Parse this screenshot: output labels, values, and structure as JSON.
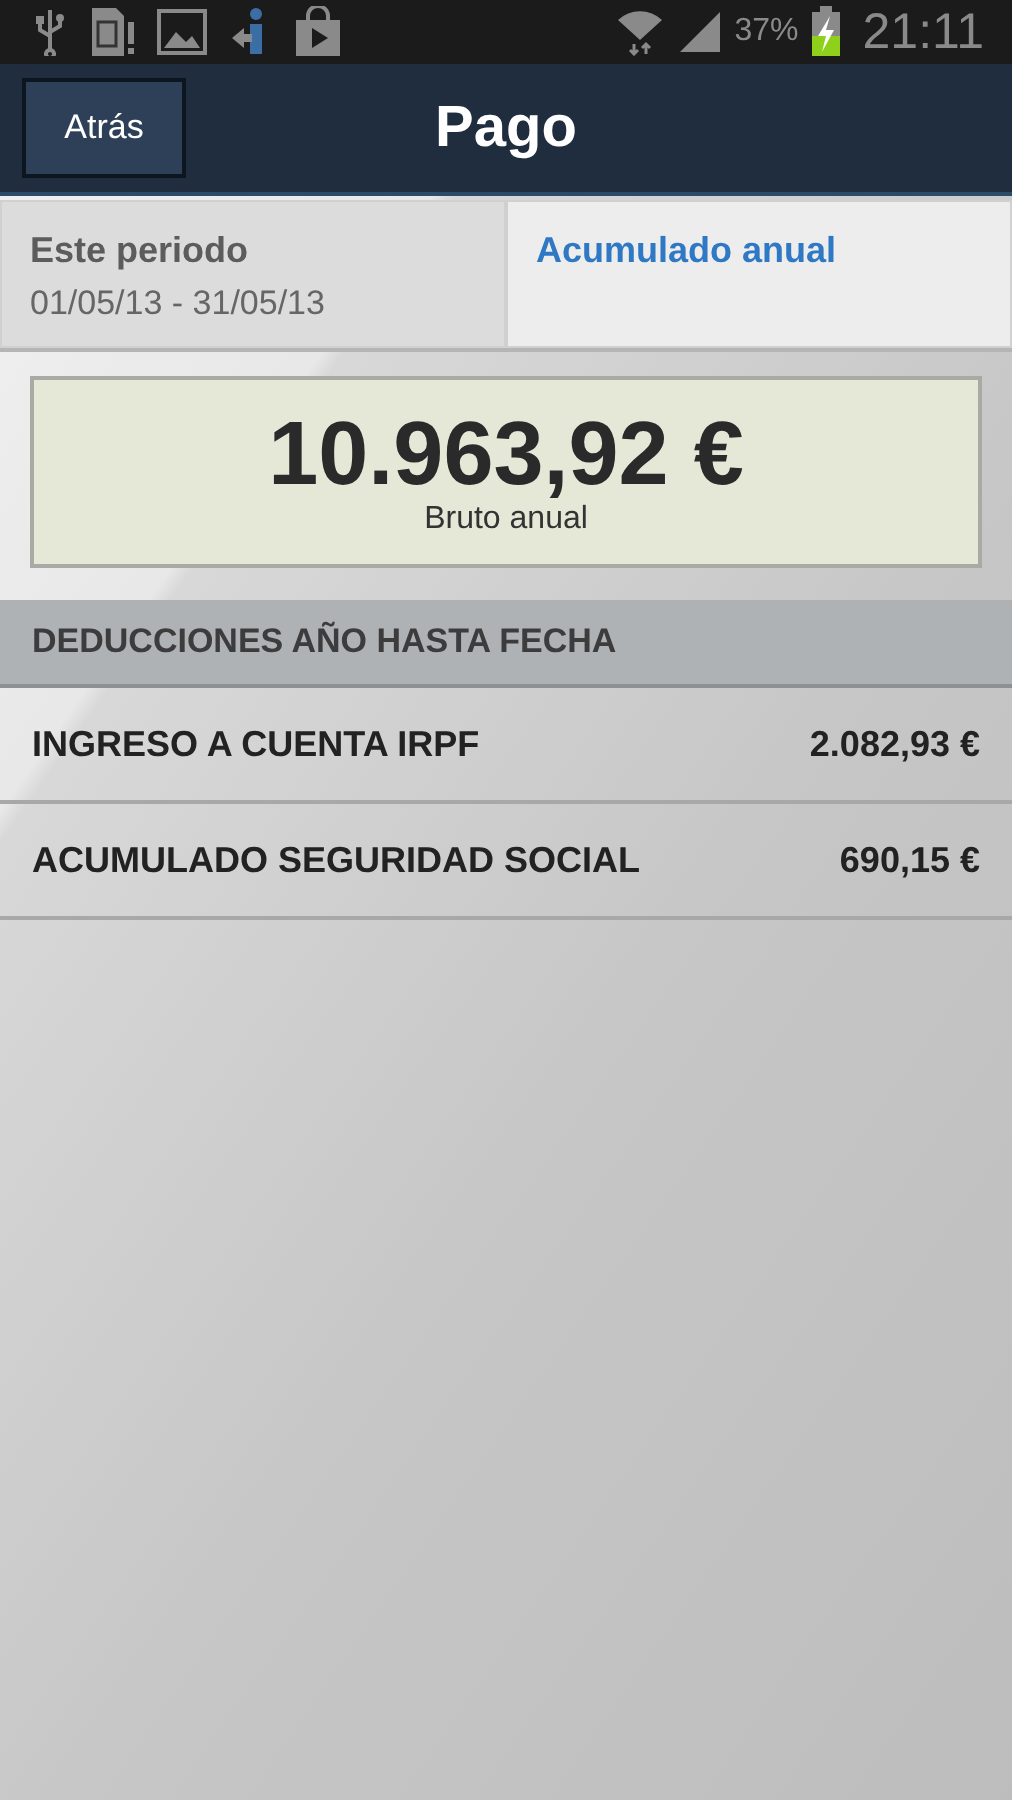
{
  "status_bar": {
    "battery_text": "37%",
    "time": "21:11"
  },
  "header": {
    "back_button": "Atrás",
    "title": "Pago"
  },
  "tabs": [
    {
      "label": "Este periodo",
      "subtitle": "01/05/13 - 31/05/13",
      "selected": false
    },
    {
      "label": "Acumulado anual",
      "selected": true
    }
  ],
  "summary": {
    "amount": "10.963,92 €",
    "caption": "Bruto anual"
  },
  "section": {
    "title": "DEDUCCIONES AÑO HASTA FECHA",
    "rows": [
      {
        "label": "INGRESO A CUENTA IRPF",
        "value": "2.082,93 €"
      },
      {
        "label": "ACUMULADO SEGURIDAD SOCIAL",
        "value": "690,15 €"
      }
    ]
  }
}
